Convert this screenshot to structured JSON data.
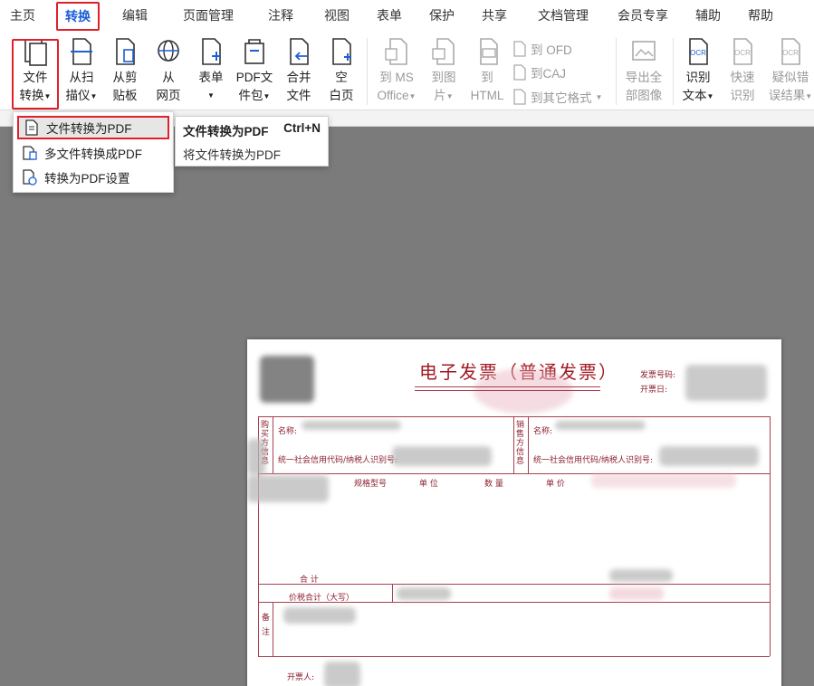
{
  "menubar": {
    "tabs": [
      "主页",
      "转换",
      "编辑",
      "页面管理",
      "注释",
      "视图",
      "表单",
      "保护",
      "共享",
      "文档管理",
      "会员专享",
      "辅助",
      "帮助"
    ],
    "active_tab": "转换"
  },
  "ribbon": {
    "file_convert": {
      "line1": "文件",
      "line2": "转换"
    },
    "scan": {
      "line1": "从扫",
      "line2": "描仪"
    },
    "clipboard": {
      "line1": "从剪",
      "line2": "贴板"
    },
    "webpage": {
      "line1": "从",
      "line2": "网页"
    },
    "form": {
      "line1": "表单",
      "line2": ""
    },
    "pdf_package": {
      "line1": "PDF文",
      "line2": "件包"
    },
    "merge": {
      "line1": "合并",
      "line2": "文件"
    },
    "blank": {
      "line1": "空",
      "line2": "白页"
    },
    "to_office": {
      "line1": "到 MS",
      "line2": "Office"
    },
    "to_image": {
      "line1": "到图",
      "line2": "片"
    },
    "to_html": {
      "line1": "到",
      "line2": "HTML"
    },
    "to_ofd": "到 OFD",
    "to_caj": "到CAJ",
    "to_other": "到其它格式",
    "export_images": {
      "line1": "导出全",
      "line2": "部图像"
    },
    "ocr_text": {
      "line1": "识别",
      "line2": "文本"
    },
    "ocr_quick": {
      "line1": "快速",
      "line2": "识别"
    },
    "ocr_suspect": {
      "line1": "疑似错",
      "line2": "误结果"
    },
    "ocr_badge": "OCR"
  },
  "dropdown": {
    "items": [
      "文件转换为PDF",
      "多文件转换成PDF",
      "转换为PDF设置"
    ]
  },
  "tooltip": {
    "title": "文件转换为PDF",
    "shortcut": "Ctrl+N",
    "description": "将文件转换为PDF"
  },
  "invoice": {
    "title": "电子发票（普通发票）",
    "invoice_no_label": "发票号码:",
    "date_label": "开票日:",
    "buyer_side": "购买方信息",
    "seller_side": "销售方信息",
    "name_label": "名称:",
    "tax_id_label": "统一社会信用代码/纳税人识别号:",
    "col_spec": "规格型号",
    "col_unit": "单 位",
    "col_qty": "数 量",
    "col_price": "单 价",
    "total_label": "合 计",
    "amount_words_label": "价税合计（大写）",
    "remarks_label": "备注",
    "issuer_label": "开票人:"
  },
  "colors": {
    "accent": "#1c5fd6",
    "highlight": "#e0202a",
    "invoice_red": "#a01a24"
  }
}
